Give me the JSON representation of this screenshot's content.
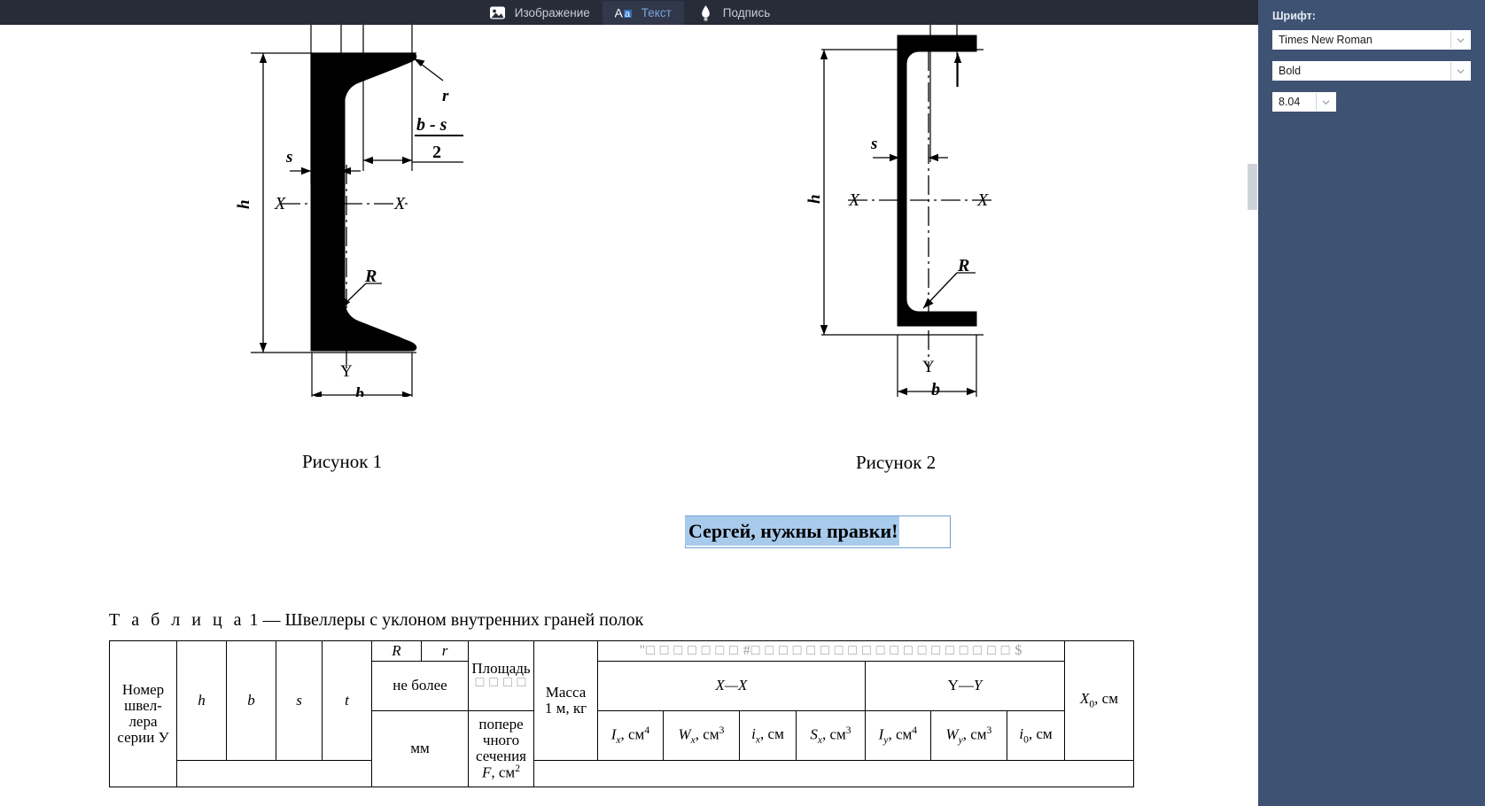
{
  "toolbar": {
    "items": [
      {
        "label": "Изображение",
        "icon": "image-icon",
        "active": false
      },
      {
        "label": "Текст",
        "icon": "text-aa-icon",
        "active": true
      },
      {
        "label": "Подпись",
        "icon": "signature-pen-icon",
        "active": false
      }
    ]
  },
  "sidebar": {
    "section_label": "Шрифт:",
    "font_family": "Times New Roman",
    "font_style": "Bold",
    "font_size": "8.04"
  },
  "document": {
    "figure1_caption": "Рисунок 1",
    "figure2_caption": "Рисунок 2",
    "figure1": {
      "h": "h",
      "b": "b",
      "s": "s",
      "r": "r",
      "R": "R",
      "x_left": "X",
      "x_right": "X",
      "y": "Y",
      "formula_num": "b - s",
      "formula_den": "2"
    },
    "figure2": {
      "h": "h",
      "b": "b",
      "s": "s",
      "R": "R",
      "x_left": "X",
      "x_right": "X",
      "y": "Y"
    },
    "annotation": {
      "text": "Сергей, нужны правки!"
    },
    "table": {
      "title_spaced": "Т а б л и ц а",
      "title_rest": " 1 — Швеллеры с уклоном внутренних граней полок",
      "header": {
        "col_number": "Номер швел-лера серии У",
        "col_h": "h",
        "col_b": "b",
        "col_s": "s",
        "col_t": "t",
        "col_R": "R",
        "col_r": "r",
        "col_no_more": "не более",
        "col_area_line1": "Площадь",
        "col_area_tofu": "□ □ □ □",
        "col_area_line2": "попере чного сечения",
        "col_area_line3": "F, см",
        "col_area_exp": "2",
        "col_mass": "Masса 1 м, кг",
        "col_mass_line1": "Масса",
        "col_mass_line2": "1 м, кг",
        "units_mm": "мм",
        "tofu_banner": "\"□ □ □ □ □ □ □ #□ □ □ □ □ □ □ □ □ □ □ □ □ □ □ □ □ □ □ $",
        "group_xx": "X—X",
        "group_yy": "Y—Y",
        "col_x0": "X0, см",
        "sub_Ix": "Ix, см4",
        "sub_Wx": "Wx, см3",
        "sub_ix": "ix, см",
        "sub_Sx": "Sx, см3",
        "sub_Iy": "Iy, см4",
        "sub_Wy": "Wy, см3",
        "sub_i0": "i0, см"
      }
    }
  }
}
